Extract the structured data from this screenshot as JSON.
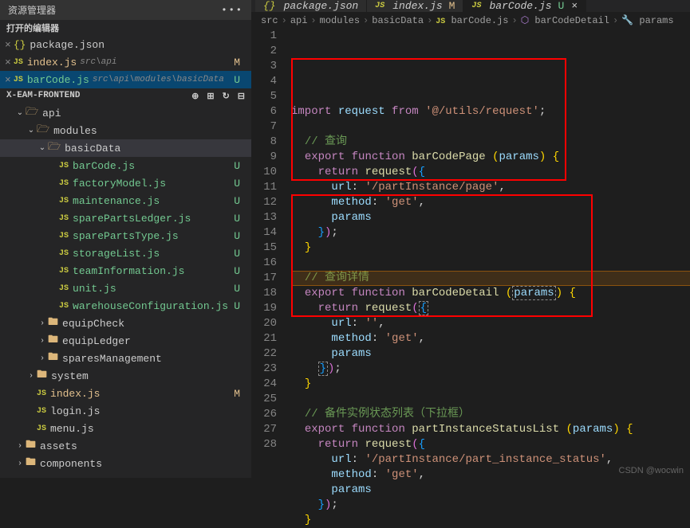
{
  "sidebar": {
    "title": "资源管理器",
    "openEditorsTitle": "打开的编辑器",
    "projectName": "X-EAM-FRONTEND",
    "openEditors": [
      {
        "icon": "json",
        "name": "package.json",
        "path": "",
        "status": ""
      },
      {
        "icon": "js",
        "name": "index.js",
        "path": "src\\api",
        "status": "M"
      },
      {
        "icon": "js",
        "name": "barCode.js",
        "path": "src\\api\\modules\\basicData",
        "status": "U",
        "active": true
      }
    ],
    "tree": [
      {
        "type": "folder-open",
        "name": "api",
        "indent": 1,
        "chevron": "down"
      },
      {
        "type": "folder-open",
        "name": "modules",
        "indent": 2,
        "chevron": "down"
      },
      {
        "type": "folder-open",
        "name": "basicData",
        "indent": 3,
        "chevron": "down",
        "active": true
      },
      {
        "type": "js",
        "name": "barCode.js",
        "indent": 4,
        "status": "U",
        "green": true
      },
      {
        "type": "js",
        "name": "factoryModel.js",
        "indent": 4,
        "status": "U",
        "green": true
      },
      {
        "type": "js",
        "name": "maintenance.js",
        "indent": 4,
        "status": "U",
        "green": true
      },
      {
        "type": "js",
        "name": "sparePartsLedger.js",
        "indent": 4,
        "status": "U",
        "green": true
      },
      {
        "type": "js",
        "name": "sparePartsType.js",
        "indent": 4,
        "status": "U",
        "green": true
      },
      {
        "type": "js",
        "name": "storageList.js",
        "indent": 4,
        "status": "U",
        "green": true
      },
      {
        "type": "js",
        "name": "teamInformation.js",
        "indent": 4,
        "status": "U",
        "green": true
      },
      {
        "type": "js",
        "name": "unit.js",
        "indent": 4,
        "status": "U",
        "green": true
      },
      {
        "type": "js",
        "name": "warehouseConfiguration.js",
        "indent": 4,
        "status": "U",
        "green": true
      },
      {
        "type": "folder",
        "name": "equipCheck",
        "indent": 3,
        "chevron": "right"
      },
      {
        "type": "folder",
        "name": "equipLedger",
        "indent": 3,
        "chevron": "right"
      },
      {
        "type": "folder",
        "name": "sparesManagement",
        "indent": 3,
        "chevron": "right"
      },
      {
        "type": "folder",
        "name": "system",
        "indent": 2,
        "chevron": "right"
      },
      {
        "type": "js",
        "name": "index.js",
        "indent": 2,
        "status": "M",
        "modified": true
      },
      {
        "type": "js",
        "name": "login.js",
        "indent": 2
      },
      {
        "type": "js",
        "name": "menu.js",
        "indent": 2
      },
      {
        "type": "folder",
        "name": "assets",
        "indent": 1,
        "chevron": "right"
      },
      {
        "type": "folder",
        "name": "components",
        "indent": 1,
        "chevron": "right"
      }
    ]
  },
  "tabs": [
    {
      "icon": "json",
      "name": "package.json",
      "mod": ""
    },
    {
      "icon": "js",
      "name": "index.js",
      "mod": "M"
    },
    {
      "icon": "js",
      "name": "barCode.js",
      "mod": "U",
      "active": true,
      "close": true
    }
  ],
  "breadcrumb": [
    "src",
    "api",
    "modules",
    "basicData",
    "barCode.js",
    "barCodeDetail",
    "params"
  ],
  "code": {
    "lines": [
      {
        "n": 1,
        "html": "<span class='kw'>import</span> <span class='ident'>request</span> <span class='kw'>from</span> <span class='str'>'@/utils/request'</span><span class='punct'>;</span>"
      },
      {
        "n": 2,
        "html": ""
      },
      {
        "n": 3,
        "html": "  <span class='comment'>// 查询</span>"
      },
      {
        "n": 4,
        "html": "  <span class='kw'>export</span> <span class='kw'>function</span> <span class='fn'>barCodePage</span> <span class='paren'>(</span><span class='ident'>params</span><span class='paren'>)</span> <span class='paren'>{</span>"
      },
      {
        "n": 5,
        "html": "    <span class='kw'>return</span> <span class='fn'>request</span><span class='paren2'>(</span><span class='paren3'>{</span>"
      },
      {
        "n": 6,
        "html": "      <span class='ident'>url</span><span class='punct'>:</span> <span class='str'>'/partInstance/page'</span><span class='punct'>,</span>"
      },
      {
        "n": 7,
        "html": "      <span class='ident'>method</span><span class='punct'>:</span> <span class='str'>'get'</span><span class='punct'>,</span>"
      },
      {
        "n": 8,
        "html": "      <span class='ident'>params</span>"
      },
      {
        "n": 9,
        "html": "    <span class='paren3'>}</span><span class='paren2'>)</span><span class='punct'>;</span>"
      },
      {
        "n": 10,
        "html": "  <span class='paren'>}</span>"
      },
      {
        "n": 11,
        "html": ""
      },
      {
        "n": 12,
        "html": "  <span class='comment'>// 查询详情</span>"
      },
      {
        "n": 13,
        "html": "  <span class='kw'>export</span> <span class='kw'>function</span> <span class='fn'>barCodeDetail</span> <span class='paren'>(</span><span class='ident param-box'>params</span><span class='paren'>)</span> <span class='paren'>{</span>"
      },
      {
        "n": 14,
        "html": "    <span class='kw'>return</span> <span class='fn'>request</span><span class='paren2'>(</span><span class='paren3 param-box'>{</span>"
      },
      {
        "n": 15,
        "html": "      <span class='ident'>url</span><span class='punct'>:</span> <span class='str'>''</span><span class='punct'>,</span>"
      },
      {
        "n": 16,
        "html": "      <span class='ident'>method</span><span class='punct'>:</span> <span class='str'>'get'</span><span class='punct'>,</span>"
      },
      {
        "n": 17,
        "html": "      <span class='ident'>params</span>"
      },
      {
        "n": 18,
        "html": "    <span class='paren3 param-box'>}</span><span class='paren2'>)</span><span class='punct'>;</span>"
      },
      {
        "n": 19,
        "html": "  <span class='paren'>}</span>"
      },
      {
        "n": 20,
        "html": ""
      },
      {
        "n": 21,
        "html": "  <span class='comment'>// 备件实例状态列表（下拉框）</span>"
      },
      {
        "n": 22,
        "html": "  <span class='kw'>export</span> <span class='kw'>function</span> <span class='fn'>partInstanceStatusList</span> <span class='paren'>(</span><span class='ident'>params</span><span class='paren'>)</span> <span class='paren'>{</span>"
      },
      {
        "n": 23,
        "html": "    <span class='kw'>return</span> <span class='fn'>request</span><span class='paren2'>(</span><span class='paren3'>{</span>"
      },
      {
        "n": 24,
        "html": "      <span class='ident'>url</span><span class='punct'>:</span> <span class='str'>'/partInstance/part_instance_status'</span><span class='punct'>,</span>"
      },
      {
        "n": 25,
        "html": "      <span class='ident'>method</span><span class='punct'>:</span> <span class='str'>'get'</span><span class='punct'>,</span>"
      },
      {
        "n": 26,
        "html": "      <span class='ident'>params</span>"
      },
      {
        "n": 27,
        "html": "    <span class='paren3'>}</span><span class='paren2'>)</span><span class='punct'>;</span>"
      },
      {
        "n": 28,
        "html": "  <span class='paren'>}</span>"
      }
    ]
  },
  "watermark": "CSDN @wocwin"
}
